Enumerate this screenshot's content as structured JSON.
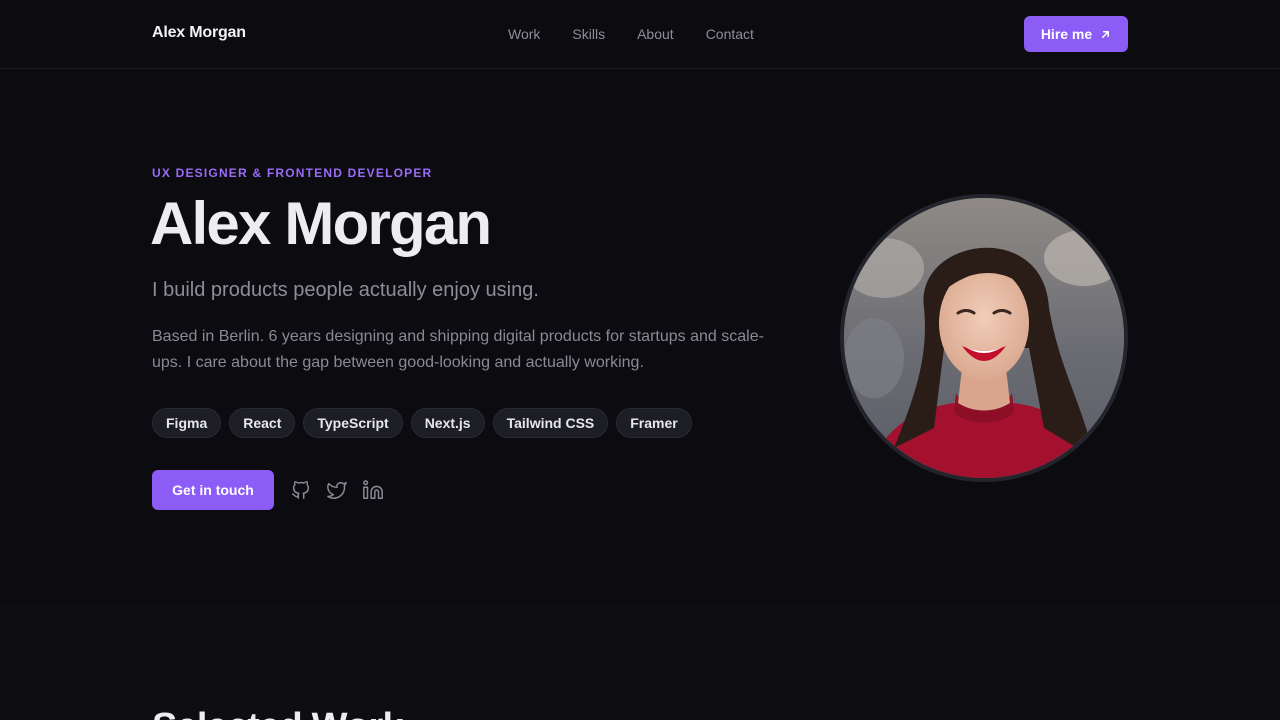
{
  "nav": {
    "brand": "Alex Morgan",
    "links": [
      "Work",
      "Skills",
      "About",
      "Contact"
    ],
    "hire_label": "Hire me"
  },
  "hero": {
    "kicker": "UX DESIGNER & FRONTEND DEVELOPER",
    "title": "Alex Morgan",
    "tagline": "I build products people actually enjoy using.",
    "bio": "Based in Berlin. 6 years designing and shipping digital products for startups and scale-ups. I care about the gap between good-looking and actually working.",
    "skills": [
      "Figma",
      "React",
      "TypeScript",
      "Next.js",
      "Tailwind CSS",
      "Framer"
    ],
    "cta_label": "Get in touch",
    "social_icons": [
      "github-icon",
      "twitter-icon",
      "linkedin-icon"
    ]
  },
  "section2": {
    "title": "Selected Work"
  },
  "colors": {
    "accent": "#8b5cf6",
    "background": "#0b0b10",
    "chip_bg": "#1d1d25"
  }
}
